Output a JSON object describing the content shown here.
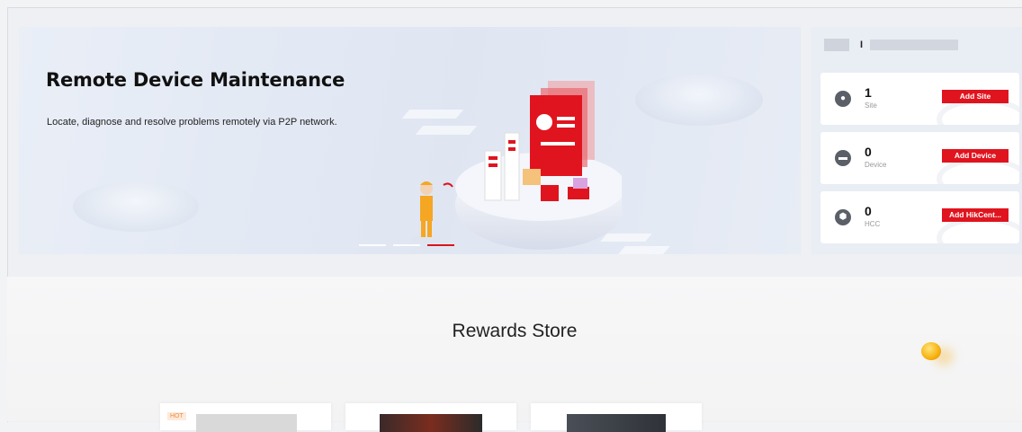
{
  "banner": {
    "title": "Remote Device Maintenance",
    "subtitle": "Locate, diagnose and resolve problems remotely via P2P network.",
    "carousel": {
      "count": 3,
      "active_index": 2
    }
  },
  "account": {
    "initial": "I"
  },
  "stats": [
    {
      "icon": "globe-icon",
      "icon_glyph": "●",
      "count": "1",
      "label": "Site",
      "button": "Add Site"
    },
    {
      "icon": "device-icon",
      "icon_glyph": "▬",
      "count": "0",
      "label": "Device",
      "button": "Add Device"
    },
    {
      "icon": "hikcentral-icon",
      "icon_glyph": "⬢",
      "count": "0",
      "label": "HCC",
      "button": "Add HikCent..."
    }
  ],
  "rewards": {
    "title": "Rewards Store",
    "products": [
      {
        "badge": "HOT"
      },
      {
        "badge": ""
      },
      {
        "badge": ""
      }
    ]
  },
  "colors": {
    "accent": "#e0141e",
    "active_dot": "#d7161b"
  }
}
